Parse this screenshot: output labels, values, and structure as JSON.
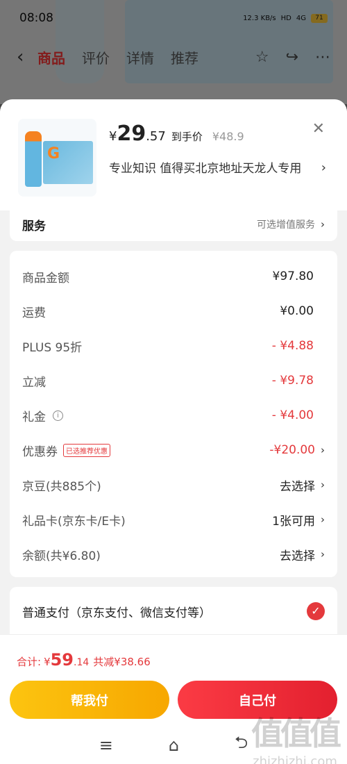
{
  "status": {
    "time": "08:08",
    "net": "12.3 KB/s",
    "hd": "HD",
    "signal": "4G",
    "battery": "71"
  },
  "topnav": {
    "tabs": [
      "商品",
      "评价",
      "详情",
      "推荐"
    ]
  },
  "product": {
    "currency": "¥",
    "price_int": "29",
    "price_dec": ".57",
    "price_tag": "到手价",
    "original_price": "¥48.9",
    "address": "专业知识  值得买北京地址天龙人专用"
  },
  "service": {
    "label": "服务",
    "option": "可选增值服务"
  },
  "fees": [
    {
      "label": "商品金额",
      "value": "¥97.80",
      "red": false,
      "chevron": false
    },
    {
      "label": "运费",
      "value": "¥0.00",
      "red": false,
      "chevron": false
    },
    {
      "label": "PLUS 95折",
      "value": "- ¥4.88",
      "red": true,
      "chevron": false
    },
    {
      "label": "立减",
      "value": "- ¥9.78",
      "red": true,
      "chevron": false
    },
    {
      "label": "礼金",
      "value": "- ¥4.00",
      "red": true,
      "chevron": false,
      "info": true
    },
    {
      "label": "优惠券",
      "value": "-¥20.00",
      "red": true,
      "chevron": true,
      "badge": "已选推荐优惠"
    },
    {
      "label": "京豆(共885个)",
      "value": "去选择",
      "red": false,
      "chevron": true
    },
    {
      "label": "礼品卡(京东卡/E卡)",
      "value": "1张可用",
      "red": false,
      "chevron": true
    },
    {
      "label": "余额(共¥6.80)",
      "value": "去选择",
      "red": false,
      "chevron": true
    }
  ],
  "payment": {
    "label": "普通支付（京东支付、微信支付等）"
  },
  "total": {
    "label": "合计:",
    "currency": "¥",
    "int": "59",
    "dec": ".14",
    "saved": "共减¥38.66"
  },
  "buttons": {
    "help": "帮我付",
    "self": "自己付"
  },
  "watermark": {
    "big": "值值值",
    "small": "zhizhizhi.com"
  },
  "colors": {
    "accent": "#e4393c",
    "help_btn": "#f7a700",
    "self_btn": "#e3202f"
  }
}
